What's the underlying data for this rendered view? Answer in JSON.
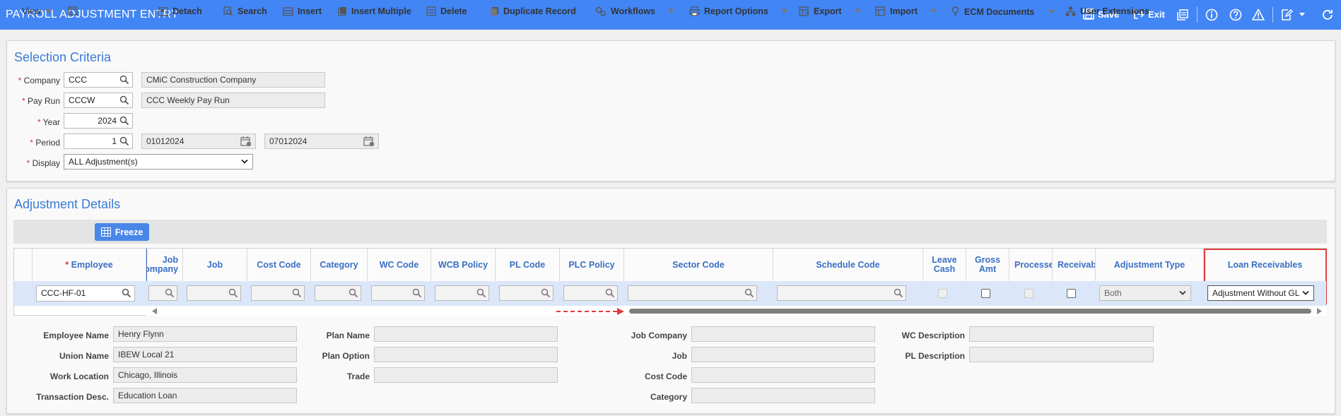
{
  "app": {
    "title": "PAYROLL ADJUSTMENT ENTRY",
    "save_label": "Save",
    "exit_label": "Exit",
    "accent": "#4285f4"
  },
  "selection": {
    "title": "Selection Criteria",
    "company_label": "Company",
    "company_value": "CCC",
    "company_name": "CMiC Construction Company",
    "payrun_label": "Pay Run",
    "payrun_value": "CCCW",
    "payrun_name": "CCC Weekly Pay Run",
    "year_label": "Year",
    "year_value": "2024",
    "period_label": "Period",
    "period_value": "1",
    "period_start": "01012024",
    "period_end": "07012024",
    "display_label": "Display",
    "display_value": "ALL Adjustment(s)"
  },
  "details": {
    "title": "Adjustment Details",
    "toolbar": {
      "view": "View",
      "freeze": "Freeze",
      "detach": "Detach",
      "search": "Search",
      "insert": "Insert",
      "insert_multiple": "Insert Multiple",
      "delete": "Delete",
      "duplicate": "Duplicate Record",
      "workflows": "Workflows",
      "report_options": "Report Options",
      "export": "Export",
      "import": "Import",
      "ecm": "ECM Documents",
      "user_ext": "User Extensions"
    },
    "columns": {
      "employee": "Employee",
      "job_company": "Job Company",
      "job": "Job",
      "cost_code": "Cost Code",
      "category": "Category",
      "wc_code": "WC Code",
      "wcb_policy": "WCB Policy",
      "pl_code": "PL Code",
      "plc_policy": "PLC Policy",
      "sector_code": "Sector Code",
      "schedule_code": "Schedule Code",
      "leave_cash": "Leave Cash",
      "gross_amt": "Gross Amt",
      "processed": "Processed",
      "receivable": "Receivable",
      "adjustment_type": "Adjustment Type",
      "loan_receivables": "Loan Receivables"
    },
    "row": {
      "employee": "CCC-HF-01",
      "adjustment_type": "Both",
      "loan_receivables": "Adjustment Without GL"
    }
  },
  "info": {
    "employee_name_label": "Employee Name",
    "employee_name": "Henry Flynn",
    "union_name_label": "Union Name",
    "union_name": "IBEW Local 21",
    "work_location_label": "Work Location",
    "work_location": "Chicago, Illinois",
    "transaction_desc_label": "Transaction Desc.",
    "transaction_desc": "Education Loan",
    "plan_name_label": "Plan Name",
    "plan_option_label": "Plan Option",
    "trade_label": "Trade",
    "job_company_label": "Job Company",
    "job_label": "Job",
    "cost_code_label": "Cost Code",
    "category_label": "Category",
    "wc_description_label": "WC Description",
    "pl_description_label": "PL Description"
  }
}
